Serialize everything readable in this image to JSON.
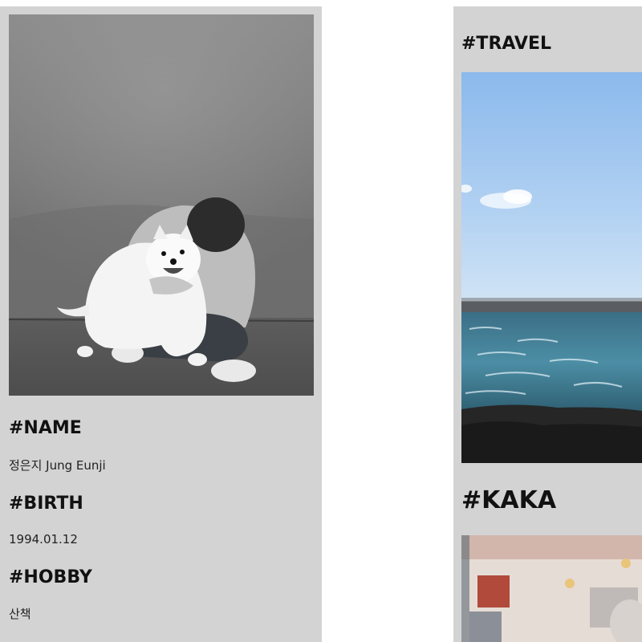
{
  "profile": {
    "name_heading": "#NAME",
    "name_value": "정은지 Jung Eunji",
    "birth_heading": "#BIRTH",
    "birth_value": "1994.01.12",
    "hobby_heading": "#HOBBY",
    "hobby_value": "산책"
  },
  "gallery": {
    "travel_heading": "#TRAVEL",
    "kaka_heading": "#KAKA"
  },
  "colors": {
    "card_background": "#d3d3d3",
    "page_background": "#ffffff"
  }
}
